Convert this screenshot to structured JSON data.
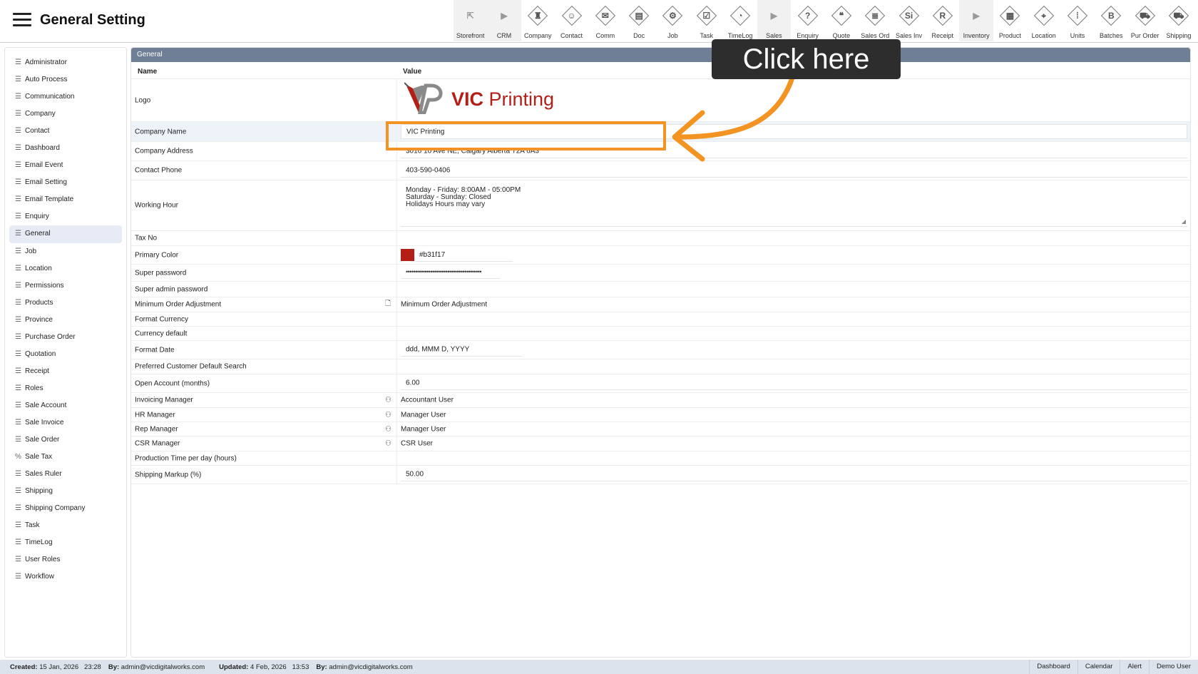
{
  "header": {
    "title": "General Setting"
  },
  "toolbar": [
    {
      "label": "Storefront",
      "glyph": "⇱",
      "icon": "external-link-icon",
      "plain": true,
      "shade": true
    },
    {
      "label": "CRM",
      "glyph": "▶",
      "icon": "triangle-right-icon",
      "plain": true,
      "shade": true
    },
    {
      "label": "Company",
      "glyph": "♜",
      "icon": "company-icon"
    },
    {
      "label": "Contact",
      "glyph": "☺",
      "icon": "contact-icon"
    },
    {
      "label": "Comm",
      "glyph": "✉",
      "icon": "comm-icon"
    },
    {
      "label": "Doc",
      "glyph": "▤",
      "icon": "doc-icon"
    },
    {
      "label": "Job",
      "glyph": "⚙",
      "icon": "job-icon"
    },
    {
      "label": "Task",
      "glyph": "☑",
      "icon": "task-icon"
    },
    {
      "label": "TimeLog",
      "glyph": "◔",
      "icon": "timelog-icon"
    },
    {
      "label": "Sales",
      "glyph": "▶",
      "icon": "triangle-right-icon",
      "plain": true,
      "shade": true
    },
    {
      "label": "Enquiry",
      "glyph": "?",
      "icon": "enquiry-icon"
    },
    {
      "label": "Quote",
      "glyph": "❝",
      "icon": "quote-icon"
    },
    {
      "label": "Sales Ord",
      "glyph": "≣",
      "icon": "sales-order-icon"
    },
    {
      "label": "Sales Inv",
      "glyph": "Si",
      "icon": "sales-invoice-icon"
    },
    {
      "label": "Receipt",
      "glyph": "R",
      "icon": "receipt-icon"
    },
    {
      "label": "Inventory",
      "glyph": "▶",
      "icon": "triangle-right-icon",
      "plain": true,
      "shade": true
    },
    {
      "label": "Product",
      "glyph": "▦",
      "icon": "product-icon"
    },
    {
      "label": "Location",
      "glyph": "⌖",
      "icon": "location-icon"
    },
    {
      "label": "Units",
      "glyph": "⦙",
      "icon": "units-icon"
    },
    {
      "label": "Batches",
      "glyph": "B",
      "icon": "batches-icon"
    },
    {
      "label": "Pur Order",
      "glyph": "⛟",
      "icon": "purchase-order-icon"
    },
    {
      "label": "Shipping",
      "glyph": "⛟",
      "icon": "shipping-icon"
    }
  ],
  "sidebar": {
    "items": [
      {
        "label": "Administrator",
        "icon": "list-icon",
        "glyph": "☰"
      },
      {
        "label": "Auto Process",
        "icon": "list-icon",
        "glyph": "☰"
      },
      {
        "label": "Communication",
        "icon": "list-icon",
        "glyph": "☰"
      },
      {
        "label": "Company",
        "icon": "list-icon",
        "glyph": "☰"
      },
      {
        "label": "Contact",
        "icon": "list-icon",
        "glyph": "☰"
      },
      {
        "label": "Dashboard",
        "icon": "list-icon",
        "glyph": "☰"
      },
      {
        "label": "Email Event",
        "icon": "list-icon",
        "glyph": "☰"
      },
      {
        "label": "Email Setting",
        "icon": "list-icon",
        "glyph": "☰"
      },
      {
        "label": "Email Template",
        "icon": "list-icon",
        "glyph": "☰"
      },
      {
        "label": "Enquiry",
        "icon": "list-icon",
        "glyph": "☰"
      },
      {
        "label": "General",
        "icon": "list-icon",
        "glyph": "☰",
        "active": true
      },
      {
        "label": "Job",
        "icon": "list-icon",
        "glyph": "☰"
      },
      {
        "label": "Location",
        "icon": "list-icon",
        "glyph": "☰"
      },
      {
        "label": "Permissions",
        "icon": "list-icon",
        "glyph": "☰"
      },
      {
        "label": "Products",
        "icon": "list-icon",
        "glyph": "☰"
      },
      {
        "label": "Province",
        "icon": "list-icon",
        "glyph": "☰"
      },
      {
        "label": "Purchase Order",
        "icon": "list-icon",
        "glyph": "☰"
      },
      {
        "label": "Quotation",
        "icon": "list-icon",
        "glyph": "☰"
      },
      {
        "label": "Receipt",
        "icon": "list-icon",
        "glyph": "☰"
      },
      {
        "label": "Roles",
        "icon": "list-icon",
        "glyph": "☰"
      },
      {
        "label": "Sale Account",
        "icon": "list-icon",
        "glyph": "☰"
      },
      {
        "label": "Sale Invoice",
        "icon": "list-icon",
        "glyph": "☰"
      },
      {
        "label": "Sale Order",
        "icon": "list-icon",
        "glyph": "☰"
      },
      {
        "label": "Sale Tax",
        "icon": "percent-icon",
        "glyph": "%"
      },
      {
        "label": "Sales Ruler",
        "icon": "list-icon",
        "glyph": "☰"
      },
      {
        "label": "Shipping",
        "icon": "list-icon",
        "glyph": "☰"
      },
      {
        "label": "Shipping Company",
        "icon": "list-icon",
        "glyph": "☰"
      },
      {
        "label": "Task",
        "icon": "list-icon",
        "glyph": "☰"
      },
      {
        "label": "TimeLog",
        "icon": "list-icon",
        "glyph": "☰"
      },
      {
        "label": "User Roles",
        "icon": "list-icon",
        "glyph": "☰"
      },
      {
        "label": "Workflow",
        "icon": "list-icon",
        "glyph": "☰"
      }
    ]
  },
  "panel": {
    "title": "General",
    "col_name": "Name",
    "col_value": "Value"
  },
  "rows": {
    "logo": {
      "name": "Logo",
      "logo_text_1": "VIC",
      "logo_text_2": " Printing"
    },
    "company_name": {
      "name": "Company Name",
      "value": "VIC Printing"
    },
    "company_address": {
      "name": "Company Address",
      "value": "3016 10 Ave NE, Calgary Alberta T2A 6A3"
    },
    "contact_phone": {
      "name": "Contact Phone",
      "value": "403-590-0406"
    },
    "working_hour": {
      "name": "Working Hour",
      "line1": "Monday - Friday: 8:00AM - 05:00PM",
      "line2": "Saturday - Sunday: Closed",
      "line3": "Holidays Hours may vary"
    },
    "tax_no": {
      "name": "Tax No",
      "value": ""
    },
    "primary_color": {
      "name": "Primary Color",
      "value": "#b31f17"
    },
    "super_password": {
      "name": "Super password",
      "value": "••••••••••••••••••••••••••••••••••••••••"
    },
    "super_admin_password": {
      "name": "Super admin password",
      "value": ""
    },
    "min_order_adjustment": {
      "name": "Minimum Order Adjustment",
      "value": "Minimum Order Adjustment"
    },
    "format_currency": {
      "name": "Format Currency",
      "value": ""
    },
    "currency_default": {
      "name": "Currency default",
      "value": ""
    },
    "format_date": {
      "name": "Format Date",
      "value": "ddd, MMM D, YYYY"
    },
    "preferred_customer_search": {
      "name": "Preferred Customer Default Search",
      "value": ""
    },
    "open_account": {
      "name": "Open Account (months)",
      "value": "6.00"
    },
    "invoicing_manager": {
      "name": "Invoicing Manager",
      "value": "Accountant User"
    },
    "hr_manager": {
      "name": "HR Manager",
      "value": "Manager User"
    },
    "rep_manager": {
      "name": "Rep Manager",
      "value": "Manager User"
    },
    "csr_manager": {
      "name": "CSR Manager",
      "value": "CSR User"
    },
    "production_time": {
      "name": "Production Time per day (hours)",
      "value": ""
    },
    "shipping_markup": {
      "name": "Shipping Markup (%)",
      "value": "50.00"
    }
  },
  "footer": {
    "created_label": "Created:",
    "created_date": "15 Jan, 2026",
    "created_time": "23:28",
    "created_by_label": "By:",
    "created_by": "admin@vicdigitalworks.com",
    "updated_label": "Updated:",
    "updated_date": "4 Feb, 2026",
    "updated_time": "13:53",
    "updated_by_label": "By:",
    "updated_by": "admin@vicdigitalworks.com",
    "links": [
      "Dashboard",
      "Calendar",
      "Alert",
      "Demo User"
    ]
  },
  "overlay": {
    "callout_text": "Click here"
  },
  "colors": {
    "primary": "#b31f17",
    "annotation": "#f39322",
    "panel_header": "#6f7f96"
  },
  "icons": {
    "menu": "hamburger-menu-icon",
    "file": "file-icon",
    "user": "user-icon"
  }
}
